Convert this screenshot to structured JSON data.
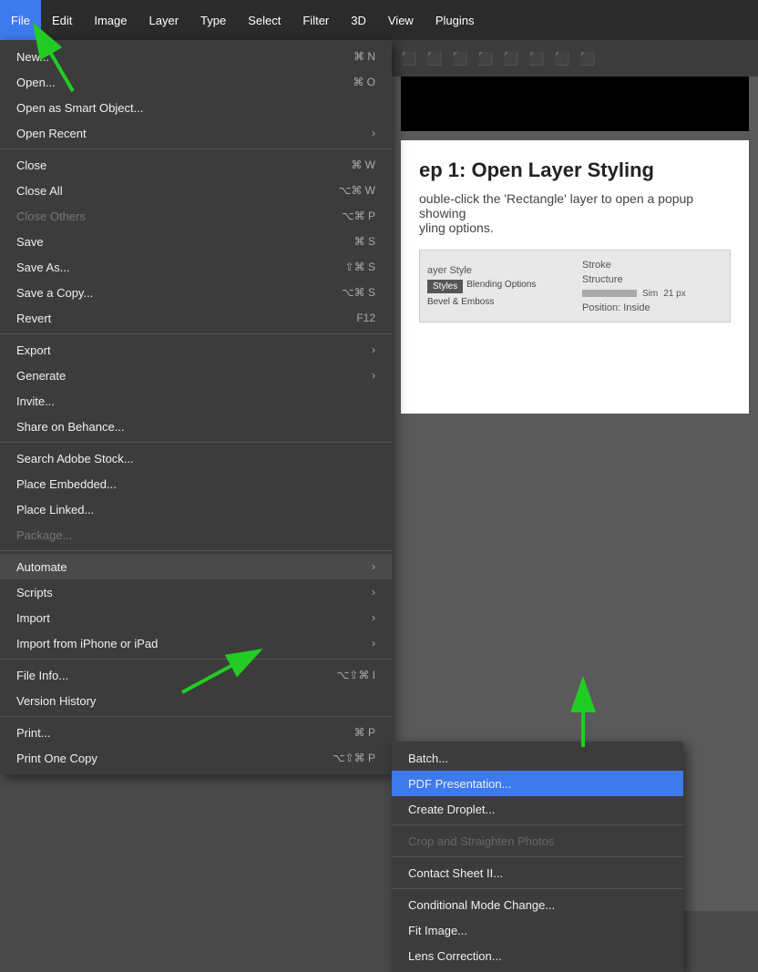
{
  "menubar": {
    "items": [
      {
        "label": "File",
        "active": true
      },
      {
        "label": "Edit",
        "active": false
      },
      {
        "label": "Image",
        "active": false
      },
      {
        "label": "Layer",
        "active": false
      },
      {
        "label": "Type",
        "active": false
      },
      {
        "label": "Select",
        "active": false
      },
      {
        "label": "Filter",
        "active": false
      },
      {
        "label": "3D",
        "active": false
      },
      {
        "label": "View",
        "active": false
      },
      {
        "label": "Plugins",
        "active": false
      }
    ]
  },
  "file_menu": {
    "items": [
      {
        "label": "New...",
        "shortcut": "⌘ N",
        "type": "item",
        "disabled": false
      },
      {
        "label": "Open...",
        "shortcut": "⌘ O",
        "type": "item",
        "disabled": false
      },
      {
        "label": "Open as Smart Object...",
        "shortcut": "",
        "type": "item",
        "disabled": false
      },
      {
        "label": "Open Recent",
        "shortcut": "",
        "type": "submenu",
        "disabled": false
      },
      {
        "type": "separator"
      },
      {
        "label": "Close",
        "shortcut": "⌘ W",
        "type": "item",
        "disabled": false
      },
      {
        "label": "Close All",
        "shortcut": "⌥⌘ W",
        "type": "item",
        "disabled": false
      },
      {
        "label": "Close Others",
        "shortcut": "⌥⌘ P",
        "type": "item",
        "disabled": true
      },
      {
        "label": "Save",
        "shortcut": "⌘ S",
        "type": "item",
        "disabled": false
      },
      {
        "label": "Save As...",
        "shortcut": "⇧⌘ S",
        "type": "item",
        "disabled": false
      },
      {
        "label": "Save a Copy...",
        "shortcut": "⌥⌘ S",
        "type": "item",
        "disabled": false
      },
      {
        "label": "Revert",
        "shortcut": "F12",
        "type": "item",
        "disabled": false
      },
      {
        "type": "separator"
      },
      {
        "label": "Export",
        "shortcut": "",
        "type": "submenu",
        "disabled": false
      },
      {
        "label": "Generate",
        "shortcut": "",
        "type": "submenu",
        "disabled": false
      },
      {
        "label": "Invite...",
        "shortcut": "",
        "type": "item",
        "disabled": false
      },
      {
        "label": "Share on Behance...",
        "shortcut": "",
        "type": "item",
        "disabled": false
      },
      {
        "type": "separator"
      },
      {
        "label": "Search Adobe Stock...",
        "shortcut": "",
        "type": "item",
        "disabled": false
      },
      {
        "label": "Place Embedded...",
        "shortcut": "",
        "type": "item",
        "disabled": false
      },
      {
        "label": "Place Linked...",
        "shortcut": "",
        "type": "item",
        "disabled": false
      },
      {
        "label": "Package...",
        "shortcut": "",
        "type": "item",
        "disabled": true
      },
      {
        "type": "separator"
      },
      {
        "label": "Automate",
        "shortcut": "",
        "type": "submenu",
        "disabled": false,
        "highlighted": true
      },
      {
        "label": "Scripts",
        "shortcut": "",
        "type": "submenu",
        "disabled": false
      },
      {
        "label": "Import",
        "shortcut": "",
        "type": "submenu",
        "disabled": false
      },
      {
        "label": "Import from iPhone or iPad",
        "shortcut": "",
        "type": "submenu",
        "disabled": false
      },
      {
        "type": "separator"
      },
      {
        "label": "File Info...",
        "shortcut": "⌥⇧⌘ I",
        "type": "item",
        "disabled": false
      },
      {
        "label": "Version History",
        "shortcut": "",
        "type": "item",
        "disabled": false
      },
      {
        "type": "separator"
      },
      {
        "label": "Print...",
        "shortcut": "⌘ P",
        "type": "item",
        "disabled": false
      },
      {
        "label": "Print One Copy",
        "shortcut": "⌥⇧⌘ P",
        "type": "item",
        "disabled": false
      }
    ]
  },
  "automate_submenu": {
    "items": [
      {
        "label": "Batch...",
        "disabled": false,
        "selected": false
      },
      {
        "label": "PDF Presentation...",
        "disabled": false,
        "selected": true
      },
      {
        "label": "Create Droplet...",
        "disabled": false,
        "selected": false
      },
      {
        "type": "separator"
      },
      {
        "label": "Crop and Straighten Photos",
        "disabled": true,
        "selected": false
      },
      {
        "type": "separator"
      },
      {
        "label": "Contact Sheet II...",
        "disabled": false,
        "selected": false
      },
      {
        "type": "separator"
      },
      {
        "label": "Conditional Mode Change...",
        "disabled": false,
        "selected": false
      },
      {
        "label": "Fit Image...",
        "disabled": false,
        "selected": false
      },
      {
        "label": "Lens Correction...",
        "disabled": false,
        "selected": false
      }
    ]
  },
  "main_content": {
    "step_title": "ep 1: Open Layer Styling",
    "step_text": "ouble-click the 'Rectangle' layer to open a popup showing",
    "step_text2": "yling options.",
    "layer_style_label": "ayer Style",
    "panel_labels": [
      "Styles",
      "Blending Options",
      "Bevel & Emboss"
    ],
    "stroke_label": "Stroke",
    "structure_label": "Structure",
    "sim_label": "Sim",
    "position_label": "Position: Inside"
  }
}
